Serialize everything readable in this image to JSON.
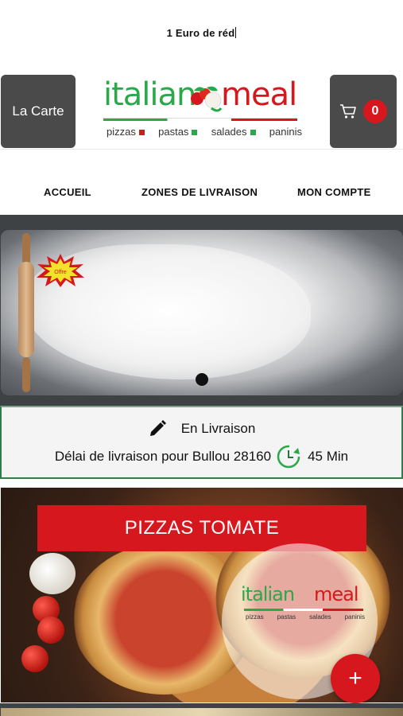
{
  "promo": {
    "text": "1 Euro de réd"
  },
  "header": {
    "menu_button": "La Carte",
    "logo": {
      "word_left": "italian",
      "word_right": "meal",
      "tagline": [
        "pizzas",
        "pastas",
        "salades",
        "paninis"
      ]
    },
    "cart_count": "0"
  },
  "nav": {
    "items": [
      {
        "label": "ACCUEIL"
      },
      {
        "label": "ZONES DE LIVRAISON"
      },
      {
        "label": "MON COMPTE"
      }
    ]
  },
  "slider": {
    "badge": "Offre",
    "active_index": 0
  },
  "delivery": {
    "mode": "En Livraison",
    "delay_label": "Délai de livraison pour Bullou 28160",
    "delay_value": "45 Min"
  },
  "category": {
    "title": "PIZZAS TOMATE",
    "add_label": "+"
  },
  "colors": {
    "brand_red": "#d7171e",
    "brand_green": "#2aa84a",
    "dark_button": "#4a4a4a",
    "band": "#3f4245"
  },
  "icons": [
    "cart-icon",
    "pencil-icon",
    "clock-icon",
    "plus-icon"
  ]
}
